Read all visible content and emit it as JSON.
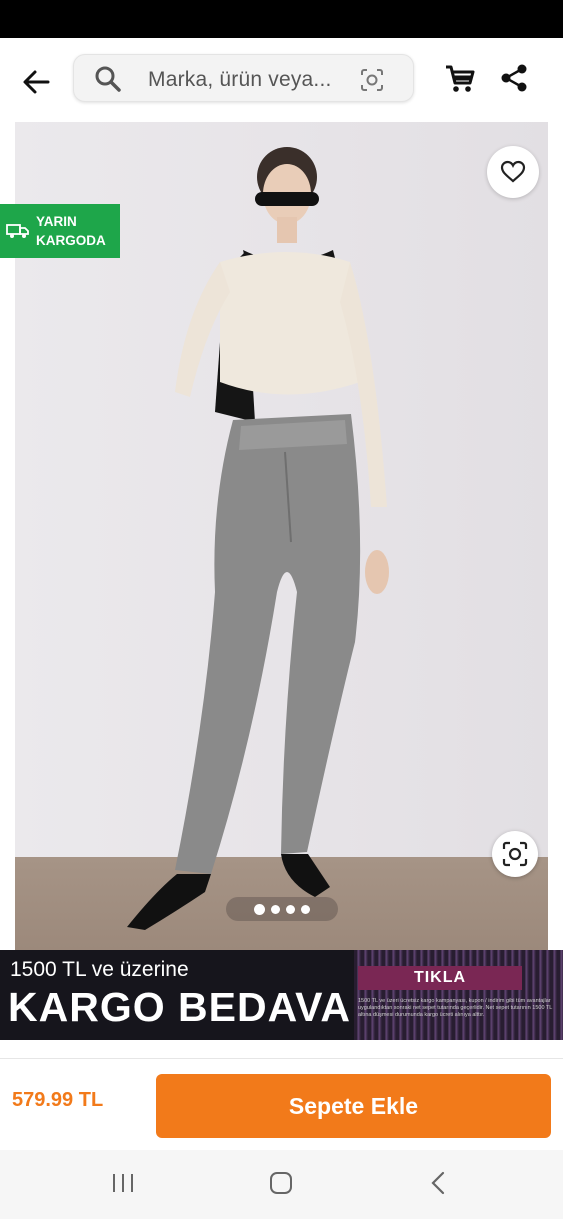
{
  "search": {
    "placeholder": "Marka, ürün veya..."
  },
  "product": {
    "badge_line1": "YARIN",
    "badge_line2": "KARGODA",
    "image_count": 4,
    "active_image": 1
  },
  "banner": {
    "line1": "1500 TL ve üzerine",
    "line2": "KARGO BEDAVA",
    "cta": "TIKLA",
    "fine_print": "1500 TL ve üzeri ücretsiz kargo kampanyası, kupon / indirim gibi tüm avantajlar uygulandıktan sonraki net sepet tutarında geçerlidir. Net sepet tutarının 1500 TL altına düşmesi durumunda kargo ücreti alınıya alttır."
  },
  "footer": {
    "price": "579.99 TL",
    "add_to_cart": "Sepete Ekle"
  },
  "colors": {
    "accent": "#f27a1a",
    "badge_green": "#1ea64a",
    "banner_bg": "#16151c",
    "cta_bg": "#7a2754"
  },
  "icons": [
    "back-arrow-icon",
    "search-icon",
    "camera-search-icon",
    "cart-icon",
    "share-icon",
    "truck-icon",
    "heart-icon",
    "lens-icon",
    "recent-apps-icon",
    "home-icon",
    "nav-back-icon"
  ]
}
